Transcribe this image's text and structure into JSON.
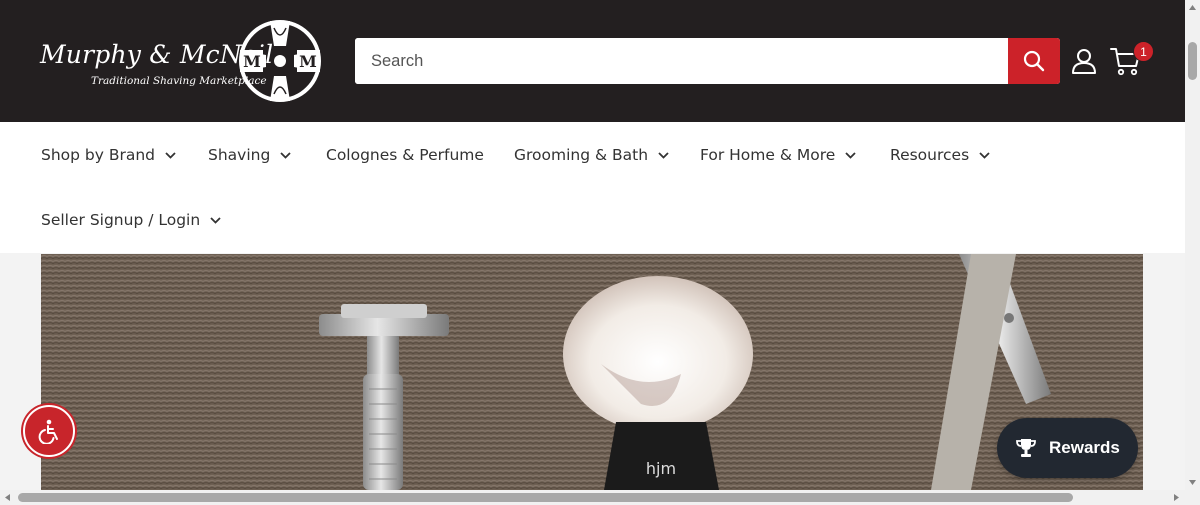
{
  "header": {
    "logo": {
      "name": "Murphy & McNeil",
      "tagline": "Traditional Shaving Marketplace",
      "monogram": "MM"
    },
    "search": {
      "placeholder": "Search",
      "value": ""
    },
    "icons": {
      "search": "search-icon",
      "account": "account-icon",
      "cart": "cart-icon"
    },
    "cart_count": "1"
  },
  "nav": {
    "items": [
      {
        "label": "Shop by Brand",
        "dropdown": true
      },
      {
        "label": "Shaving",
        "dropdown": true
      },
      {
        "label": "Colognes & Perfume",
        "dropdown": false
      },
      {
        "label": "Grooming & Bath",
        "dropdown": true
      },
      {
        "label": "For Home & More",
        "dropdown": true
      },
      {
        "label": "Resources",
        "dropdown": true
      },
      {
        "label": "Seller Signup / Login",
        "dropdown": true
      }
    ]
  },
  "hero": {
    "brush_label": "hjm"
  },
  "widgets": {
    "accessibility_icon": "wheelchair-icon",
    "rewards_label": "Rewards",
    "rewards_icon": "trophy-icon"
  },
  "colors": {
    "header_bg": "#231f20",
    "accent": "#cc2229",
    "nav_bg": "#ffffff",
    "rewards_bg": "#222831"
  }
}
